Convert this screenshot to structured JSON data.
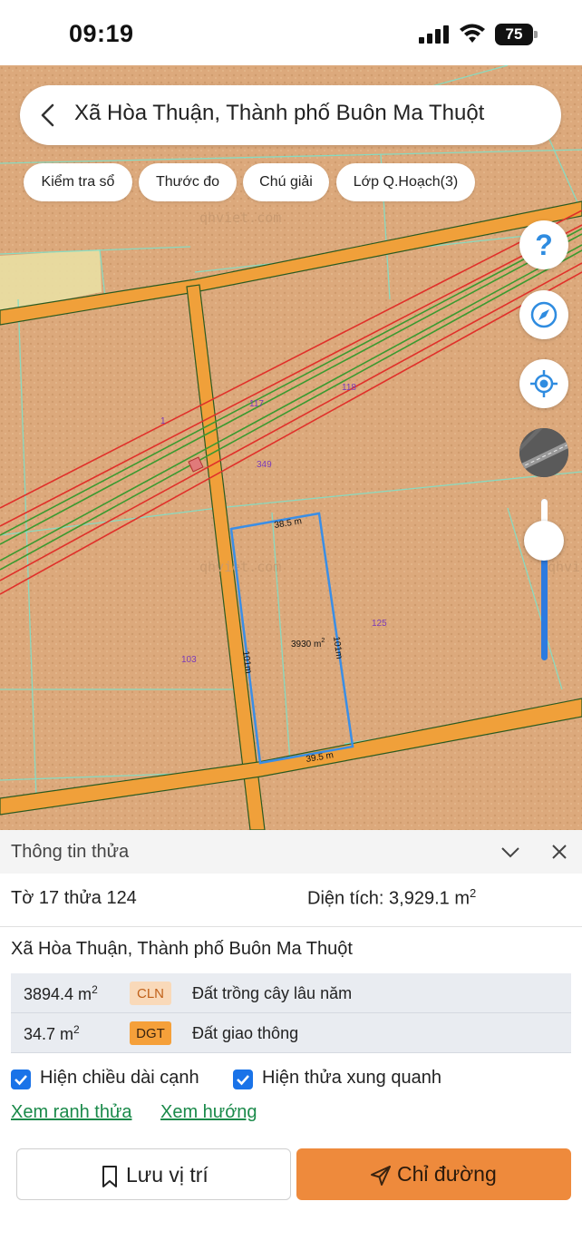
{
  "status_bar": {
    "time": "09:19",
    "battery": "75"
  },
  "search": {
    "title": "Xã Hòa Thuận, Thành phố Buôn Ma Thuột"
  },
  "chips": [
    "Kiểm tra sổ",
    "Thước đo",
    "Chú giải",
    "Lớp Q.Hoạch(3)"
  ],
  "map": {
    "watermark": "qhviet.com",
    "watermark_cut": "qhvi",
    "parcel_labels": [
      "117",
      "118",
      "1",
      "349",
      "125",
      "103"
    ],
    "edge_top": "38.5 m",
    "edge_bottom": "39.5 m",
    "edge_left": "101m",
    "edge_right": "101m",
    "parcel_area": "3930 m",
    "parcel_area_sup": "2"
  },
  "map_controls": {
    "help": "?",
    "zoom_level": 0.82
  },
  "panel": {
    "title": "Thông tin thửa",
    "sheet": "Tờ 17 thửa 124",
    "area_label": "Diện tích: 3,929.1 m",
    "area_sup": "2",
    "address": "Xã Hòa Thuận, Thành phố Buôn Ma Thuột",
    "land_uses": [
      {
        "area": "3894.4 m",
        "sup": "2",
        "code": "CLN",
        "code_bg": "#f9d9b9",
        "code_color": "#c0611a",
        "desc": "Đất trồng cây lâu năm"
      },
      {
        "area": "34.7 m",
        "sup": "2",
        "code": "DGT",
        "code_bg": "#f5a03a",
        "code_color": "#3a2410",
        "desc": "Đất giao thông"
      }
    ],
    "show_edge_length": "Hiện chiều dài cạnh",
    "show_neighbors": "Hiện thửa xung quanh",
    "link_boundary": "Xem ranh thửa",
    "link_direction": "Xem hướng",
    "save_label": "Lưu vị trí",
    "route_label": "Chỉ đường"
  },
  "colors": {
    "accent": "#ee8a3c",
    "primary_blue": "#1a73e8",
    "link_green": "#1a8a4a",
    "parcel_outline": "#3a8ee6"
  }
}
